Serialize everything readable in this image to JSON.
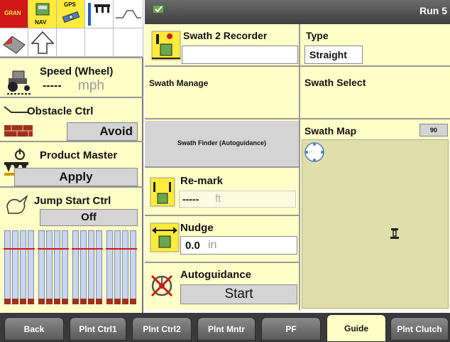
{
  "status_bar": {
    "gran_label": "GRAN",
    "nav_label": "NAV",
    "gps_label": "GPS"
  },
  "left": {
    "speed": {
      "title": "Speed (Wheel)",
      "value": "-----",
      "unit": "mph"
    },
    "obstacle": {
      "title": "Obstacle Ctrl",
      "button": "Avoid"
    },
    "product_master": {
      "title": "Product Master",
      "button": "Apply"
    },
    "jump_start": {
      "title": "Jump Start Ctrl",
      "button": "Off"
    }
  },
  "top": {
    "run": "Run 5"
  },
  "middle": {
    "swath_recorder": {
      "title": "Swath 2 Recorder",
      "value": ""
    },
    "swath_manage": "Swath Manage",
    "swath_finder": "Swath Finder (Autoguidance)",
    "remark": {
      "title": "Re-mark",
      "value": "-----",
      "unit": "ft"
    },
    "nudge": {
      "title": "Nudge",
      "value": "0.0",
      "unit": "in"
    },
    "autoguidance": {
      "title": "Autoguidance",
      "button": "Start"
    }
  },
  "right": {
    "type": {
      "title": "Type",
      "value": "Straight"
    },
    "swath_select": "Swath Select",
    "swath_map": {
      "title": "Swath Map",
      "zoom": "90"
    }
  },
  "tabs": [
    {
      "label": "Back"
    },
    {
      "label": "Plnt Ctrl1"
    },
    {
      "label": "Plnt Ctrl2"
    },
    {
      "label": "Plnt Mntr"
    },
    {
      "label": "PF"
    },
    {
      "label": "Guide"
    },
    {
      "label": "Plnt Clutch"
    }
  ],
  "colors": {
    "panel": "#ffffc8",
    "button": "#d4d4d4",
    "tab": "#6a6a6a",
    "accent_red": "#d01818"
  }
}
